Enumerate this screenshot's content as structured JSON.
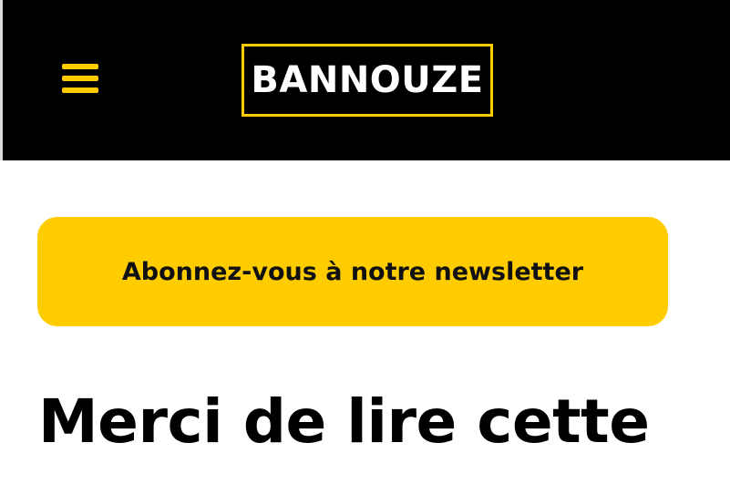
{
  "header": {
    "menu_icon": "hamburger-menu-icon",
    "logo_text": "BANNOUZE",
    "background": "#000000",
    "accent": "#ffcc00"
  },
  "newsletter": {
    "label": "Abonnez-vous à notre newsletter",
    "background": "#ffcc00"
  },
  "article": {
    "heading": "Merci de lire cette"
  }
}
